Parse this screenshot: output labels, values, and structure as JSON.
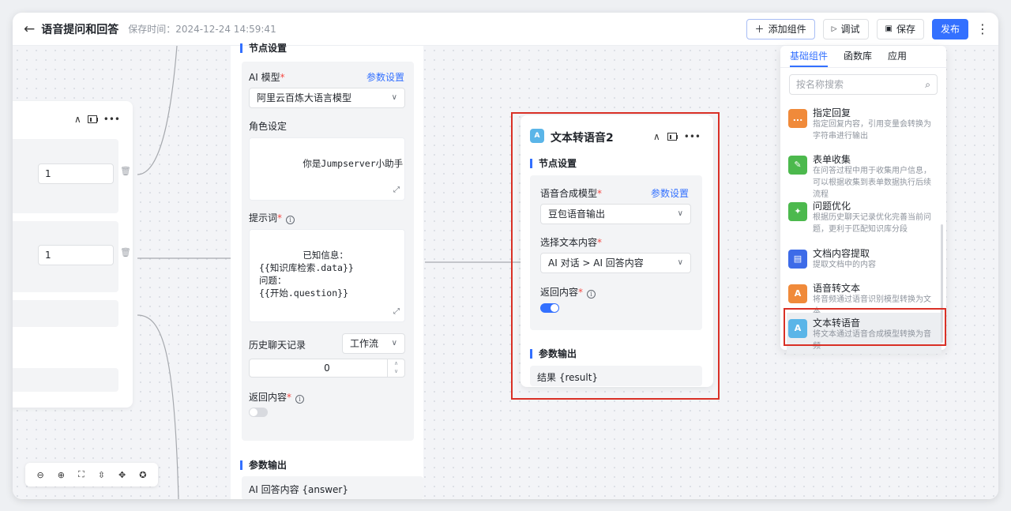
{
  "header": {
    "title": "语音提问和回答",
    "save_time": "保存时间：2024-12-24 14:59:41",
    "add_component": "添加组件",
    "debug": "调试",
    "save": "保存",
    "publish": "发布"
  },
  "left_node": {
    "input1_value": "1",
    "input2_value": "1"
  },
  "mid_panel": {
    "section_title": "节点设置",
    "ai_model_label": "AI 模型",
    "param_settings": "参数设置",
    "ai_model_value": "阿里云百炼大语言模型",
    "role_label": "角色设定",
    "role_value": "你是Jumpserver小助手",
    "prompt_label": "提示词",
    "prompt_value": "已知信息：\n{{知识库检索.data}}\n问题：\n{{开始.question}}",
    "history_label": "历史聊天记录",
    "history_select": "工作流",
    "history_count": "0",
    "return_label": "返回内容",
    "output_title": "参数输出",
    "output_value": "AI 回答内容 {answer}"
  },
  "center_node": {
    "icon_text": "A",
    "title": "文本转语音2",
    "section_title": "节点设置",
    "tts_model_label": "语音合成模型",
    "param_settings": "参数设置",
    "tts_model_value": "豆包语音输出",
    "text_content_label": "选择文本内容",
    "text_content_value": "AI 对话 > AI 回答内容",
    "return_label": "返回内容",
    "output_title": "参数输出",
    "output_value": "结果 {result}"
  },
  "component_panel": {
    "tabs": [
      "基础组件",
      "函数库",
      "应用"
    ],
    "search_placeholder": "按名称搜索",
    "items": [
      {
        "name": "指定回复",
        "desc": "指定回复内容，引用变量会转换为字符串进行输出",
        "color": "#f08a3a",
        "icon": "..."
      },
      {
        "name": "表单收集",
        "desc": "在问答过程中用于收集用户信息，可以根据收集到表单数据执行后续流程",
        "color": "#4cb94d",
        "icon": "✎"
      },
      {
        "name": "问题优化",
        "desc": "根据历史聊天记录优化完善当前问题，更利于匹配知识库分段",
        "color": "#4cb94d",
        "icon": "✦"
      },
      {
        "name": "文档内容提取",
        "desc": "提取文档中的内容",
        "color": "#3d6be8",
        "icon": "▤"
      },
      {
        "name": "语音转文本",
        "desc": "将音频通过语音识别模型转换为文本",
        "color": "#f08a3a",
        "icon": "A"
      },
      {
        "name": "文本转语音",
        "desc": "将文本通过语音合成模型转换为音频",
        "color": "#5ab5e8",
        "icon": "A"
      }
    ]
  },
  "colors": {
    "accent": "#3370ff",
    "highlight_border": "#d93026",
    "toggle_on": "#3370ff",
    "toggle_off": "#d8dadf"
  },
  "toggles": {
    "mid_return_on": false,
    "center_return_on": true
  }
}
